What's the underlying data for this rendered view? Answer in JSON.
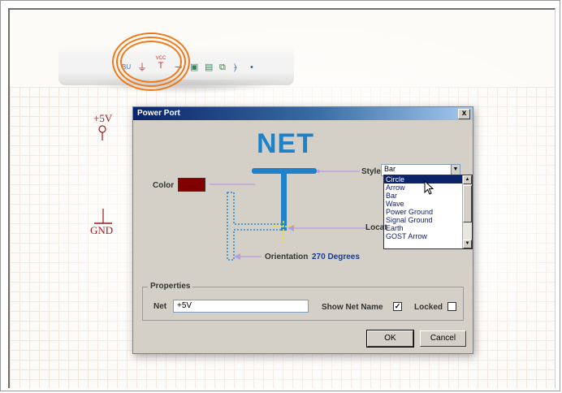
{
  "toolbar": {
    "icons": [
      {
        "name": "bus-icon",
        "glyph": "BU"
      },
      {
        "name": "gnd-power-port-icon",
        "glyph": "⏚"
      },
      {
        "name": "vcc-power-port-icon",
        "glyph": "T"
      },
      {
        "name": "port-icon",
        "glyph": "⊸"
      },
      {
        "name": "sheet-entry-icon",
        "glyph": "▣"
      },
      {
        "name": "sheet-symbol-icon",
        "glyph": "▤"
      },
      {
        "name": "harness-icon",
        "glyph": "⧉"
      },
      {
        "name": "signal-harness-icon",
        "glyph": "⦒"
      },
      {
        "name": "no-erc-icon",
        "glyph": "•"
      }
    ],
    "vcc_label": "VCC"
  },
  "schematic": {
    "plus5v_label": "+5V",
    "gnd_label": "GND"
  },
  "dialog": {
    "title": "Power Port",
    "close_glyph": "x",
    "net_preview": "NET",
    "color_label": "Color",
    "color_value": "#800000",
    "style_label": "Style",
    "style_selected": "Bar",
    "style_options": [
      "Circle",
      "Arrow",
      "Bar",
      "Wave",
      "Power Ground",
      "Signal Ground",
      "Earth",
      "GOST Arrow"
    ],
    "style_highlighted": "Circle",
    "location_label": "Locat",
    "orientation_label": "Orientation",
    "orientation_value": "270 Degrees",
    "properties_label": "Properties",
    "net_label": "Net",
    "net_value": "+5V",
    "show_net_name_label": "Show Net Name",
    "show_net_name_checked": true,
    "locked_label": "Locked",
    "locked_checked": false,
    "ok_label": "OK",
    "cancel_label": "Cancel"
  },
  "colors": {
    "highlight_ring": "#ee7a1b",
    "titlebar": "#0a246a",
    "net_symbol": "#1f82c8",
    "guide_line": "#b99be0"
  }
}
